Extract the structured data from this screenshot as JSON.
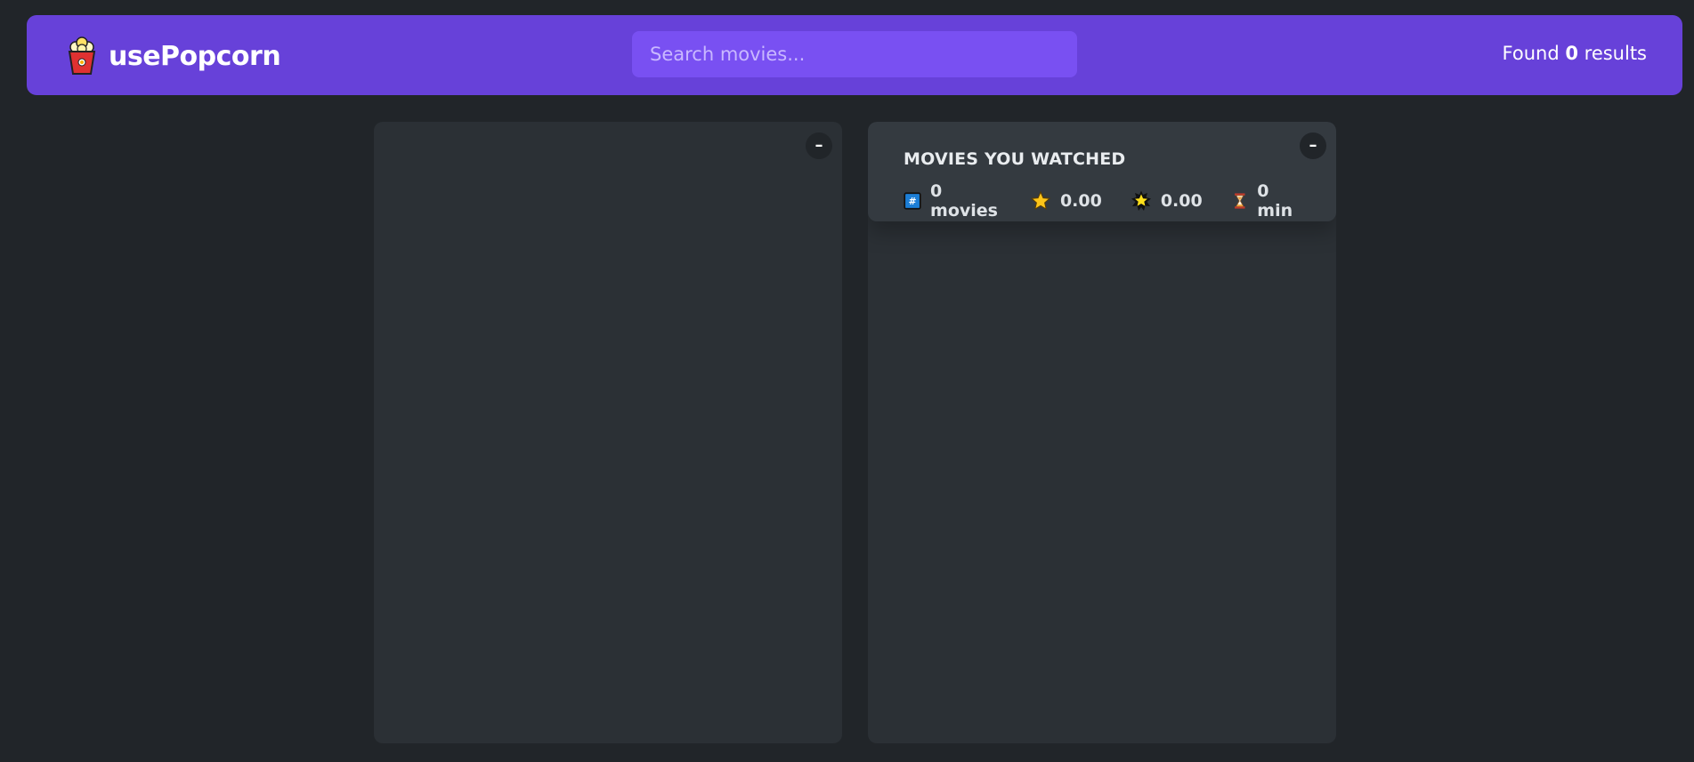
{
  "app": {
    "name": "usePopcorn",
    "logo_icon": "popcorn-icon"
  },
  "search": {
    "placeholder": "Search movies...",
    "value": ""
  },
  "results": {
    "prefix": "Found ",
    "count": "0",
    "suffix": " results"
  },
  "left_box": {
    "toggle_label": "–",
    "items": []
  },
  "right_box": {
    "toggle_label": "–",
    "summary": {
      "title": "Movies you watched",
      "stats": [
        {
          "icon": "hash-icon",
          "value": "0 movies"
        },
        {
          "icon": "star-icon",
          "value": "0.00"
        },
        {
          "icon": "glowing-star-icon",
          "value": "0.00"
        },
        {
          "icon": "hourglass-icon",
          "value": "0 min"
        }
      ]
    },
    "items": []
  },
  "colors": {
    "background": "#212529",
    "nav": "#6741d9",
    "search": "#7950f2",
    "box": "#2b3035",
    "summary": "#343a40"
  }
}
